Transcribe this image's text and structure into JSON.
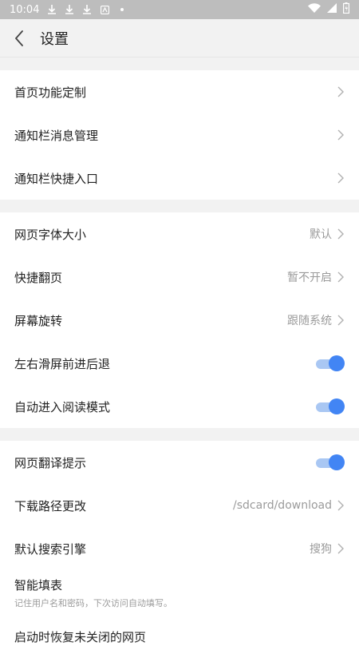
{
  "status_bar": {
    "time": "10:04"
  },
  "header": {
    "title": "设置"
  },
  "sections": [
    {
      "items": [
        {
          "label": "首页功能定制"
        },
        {
          "label": "通知栏消息管理"
        },
        {
          "label": "通知栏快捷入口"
        }
      ]
    },
    {
      "items": [
        {
          "label": "网页字体大小",
          "value": "默认"
        },
        {
          "label": "快捷翻页",
          "value": "暂不开启"
        },
        {
          "label": "屏幕旋转",
          "value": "跟随系统"
        },
        {
          "label": "左右滑屏前进后退",
          "toggle": true
        },
        {
          "label": "自动进入阅读模式",
          "toggle": true
        }
      ]
    },
    {
      "items": [
        {
          "label": "网页翻译提示",
          "toggle": true
        },
        {
          "label": "下载路径更改",
          "value": "/sdcard/download"
        },
        {
          "label": "默认搜索引擎",
          "value": "搜狗"
        },
        {
          "label": "智能填表",
          "subtitle": "记住用户名和密码，下次访问自动填写。"
        },
        {
          "label": "启动时恢复未关闭的网页"
        }
      ]
    }
  ],
  "colors": {
    "accent": "#4285f4",
    "toggle_track": "#a9c7f3",
    "status_bar": "#bdbdbd"
  }
}
